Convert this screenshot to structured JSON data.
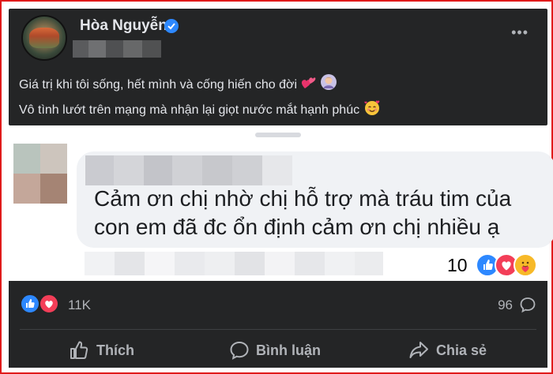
{
  "post": {
    "author_name": "Hòa Nguyễn",
    "caption_line1": "Giá trị khi tôi sống, hết mình và cống hiến cho đời",
    "caption_line2": "Vô tình lướt trên mạng mà nhận lại giọt nước mắt hạnh phúc"
  },
  "comment": {
    "text": "Cảm ơn chị nhờ chị hỗ trợ mà tráu tim của con em đã đc ổn định cảm ơn chị nhiều ạ",
    "reaction_count": "10"
  },
  "footer": {
    "reaction_count": "11K",
    "comment_count": "96",
    "like_label": "Thích",
    "comment_label": "Bình luận",
    "share_label": "Chia sẻ"
  },
  "colors": {
    "dark_bg": "#242526",
    "border": "#e01a1a",
    "accent_blue": "#2d88ff",
    "love_red": "#f33e58"
  },
  "icons": [
    "verified-badge-icon",
    "more-options-icon",
    "heart-emoji-icon",
    "woman-emoji-icon",
    "smiling-hearts-emoji-icon",
    "like-reaction-icon",
    "love-reaction-icon",
    "care-reaction-icon",
    "comment-count-icon",
    "like-icon",
    "comment-icon",
    "share-icon"
  ]
}
